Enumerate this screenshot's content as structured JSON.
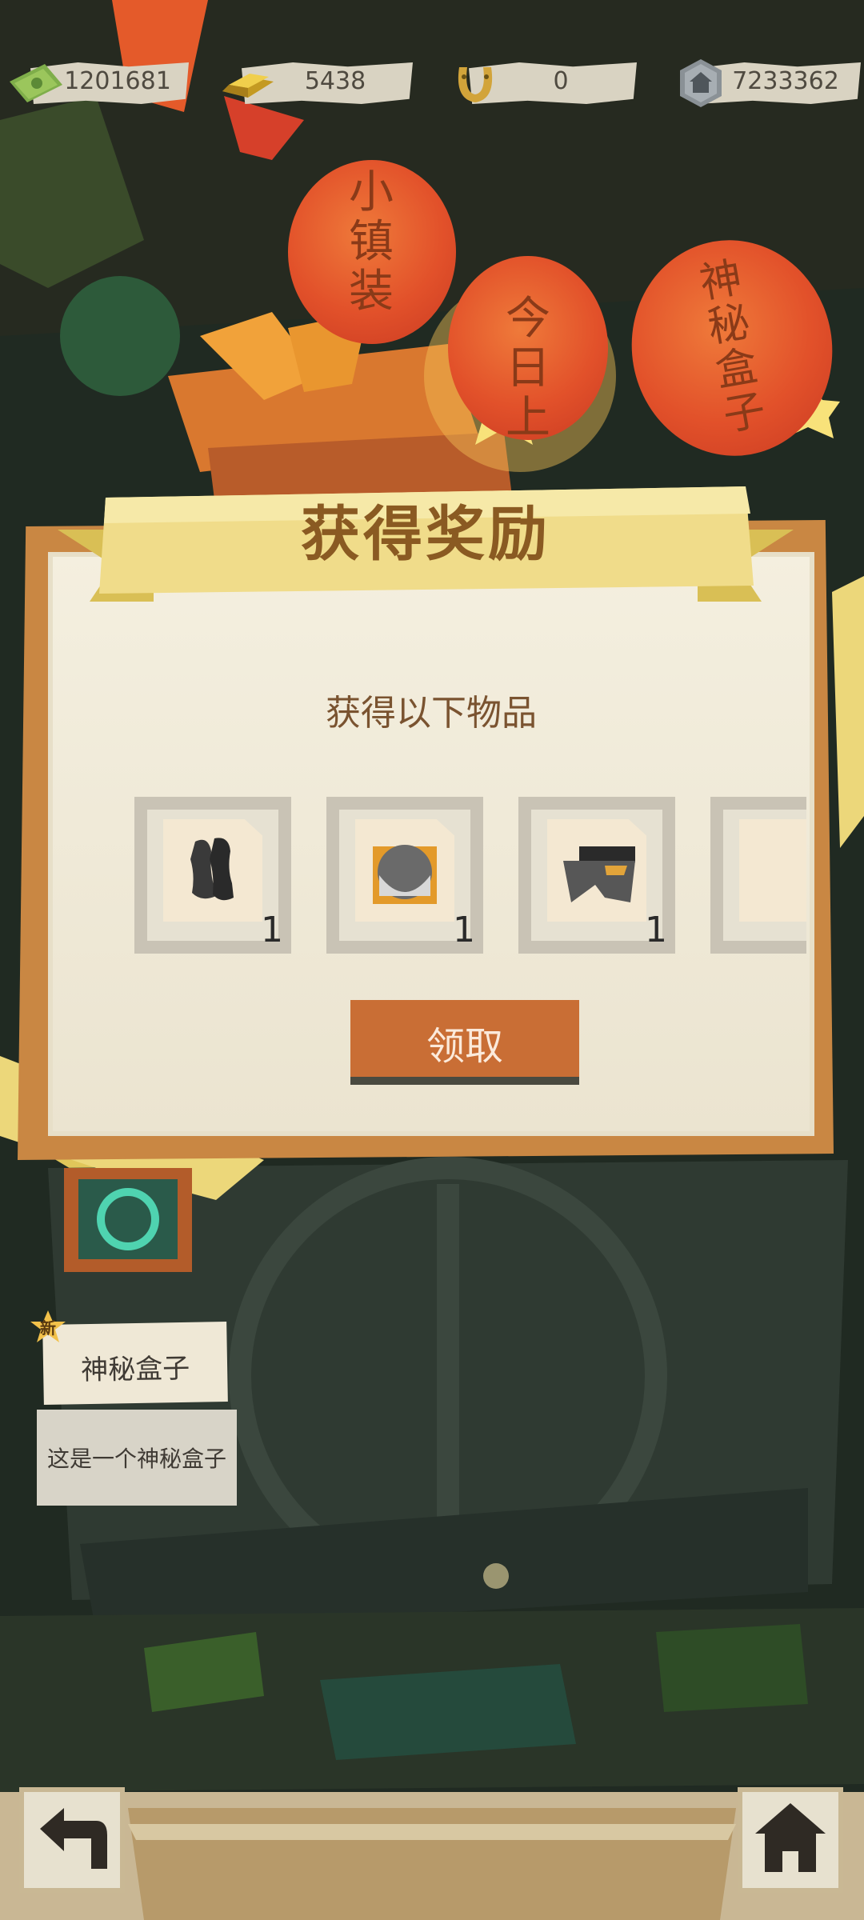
{
  "currencies": [
    {
      "name": "cash",
      "icon": "banknote-icon",
      "value": "1201681"
    },
    {
      "name": "gold",
      "icon": "gold-bar-icon",
      "value": "5438"
    },
    {
      "name": "horseshoe",
      "icon": "horseshoe-icon",
      "value": "0"
    },
    {
      "name": "token",
      "icon": "house-coin-icon",
      "value": "7233362"
    }
  ],
  "lanterns": [
    {
      "text": "小镇装"
    },
    {
      "text": "今日上"
    },
    {
      "text": "神秘盒子"
    }
  ],
  "dialog": {
    "title": "获得奖励",
    "subtitle": "获得以下物品",
    "items": [
      {
        "icon": "boots-icon",
        "count": "1"
      },
      {
        "icon": "helmet-icon",
        "count": "1"
      },
      {
        "icon": "pants-icon",
        "count": "1"
      },
      {
        "icon": "giraffe-icon",
        "count": ""
      }
    ],
    "claim_label": "领取"
  },
  "info_card": {
    "badge": "新",
    "title": "神秘盒子",
    "description": "这是一个神秘盒子"
  },
  "nav": {
    "back_icon": "back-arrow-icon",
    "home_icon": "home-icon"
  },
  "colors": {
    "accent": "#c96e35",
    "ribbon": "#f0dc8a",
    "frame": "#c98743"
  }
}
